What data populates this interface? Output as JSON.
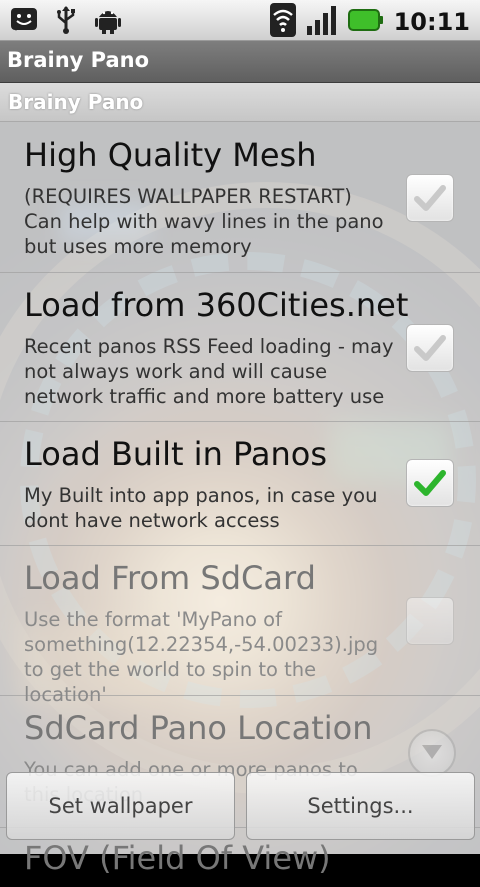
{
  "status_bar": {
    "time": "10:11",
    "left_icons": [
      "android-face-icon",
      "usb-icon",
      "android-robot-icon"
    ],
    "right_icons": [
      "wifi-icon",
      "signal-icon",
      "battery-icon"
    ]
  },
  "app_title": "Brainy Pano",
  "category_title": "Brainy Pano",
  "preferences": [
    {
      "title": "High Quality Mesh",
      "summary": "(REQUIRES WALLPAPER RESTART) Can help with wavy lines in the pano but uses more memory",
      "checked": false,
      "enabled": true
    },
    {
      "title": "Load from 360Cities.net",
      "summary": "Recent panos RSS Feed loading - may not always work and will cause network traffic and more battery use",
      "checked": false,
      "enabled": true
    },
    {
      "title": "Load Built in Panos",
      "summary": "My Built into app panos, in case you dont have network access",
      "checked": true,
      "enabled": true
    },
    {
      "title": "Load From SdCard",
      "summary": "Use the format 'MyPano of something(12.22354,-54.00233).jpg to get the world to spin to the location'",
      "checked": false,
      "enabled": false
    },
    {
      "title": "SdCard Pano Location",
      "summary": "You can add one or more panos to this location",
      "enabled": false
    },
    {
      "title": "FOV (Field Of View)",
      "enabled": false
    }
  ],
  "buttons": {
    "set_wallpaper": "Set wallpaper",
    "settings": "Settings..."
  },
  "colors": {
    "check_green": "#2db52d",
    "title_bar": "#6e6e6e"
  }
}
